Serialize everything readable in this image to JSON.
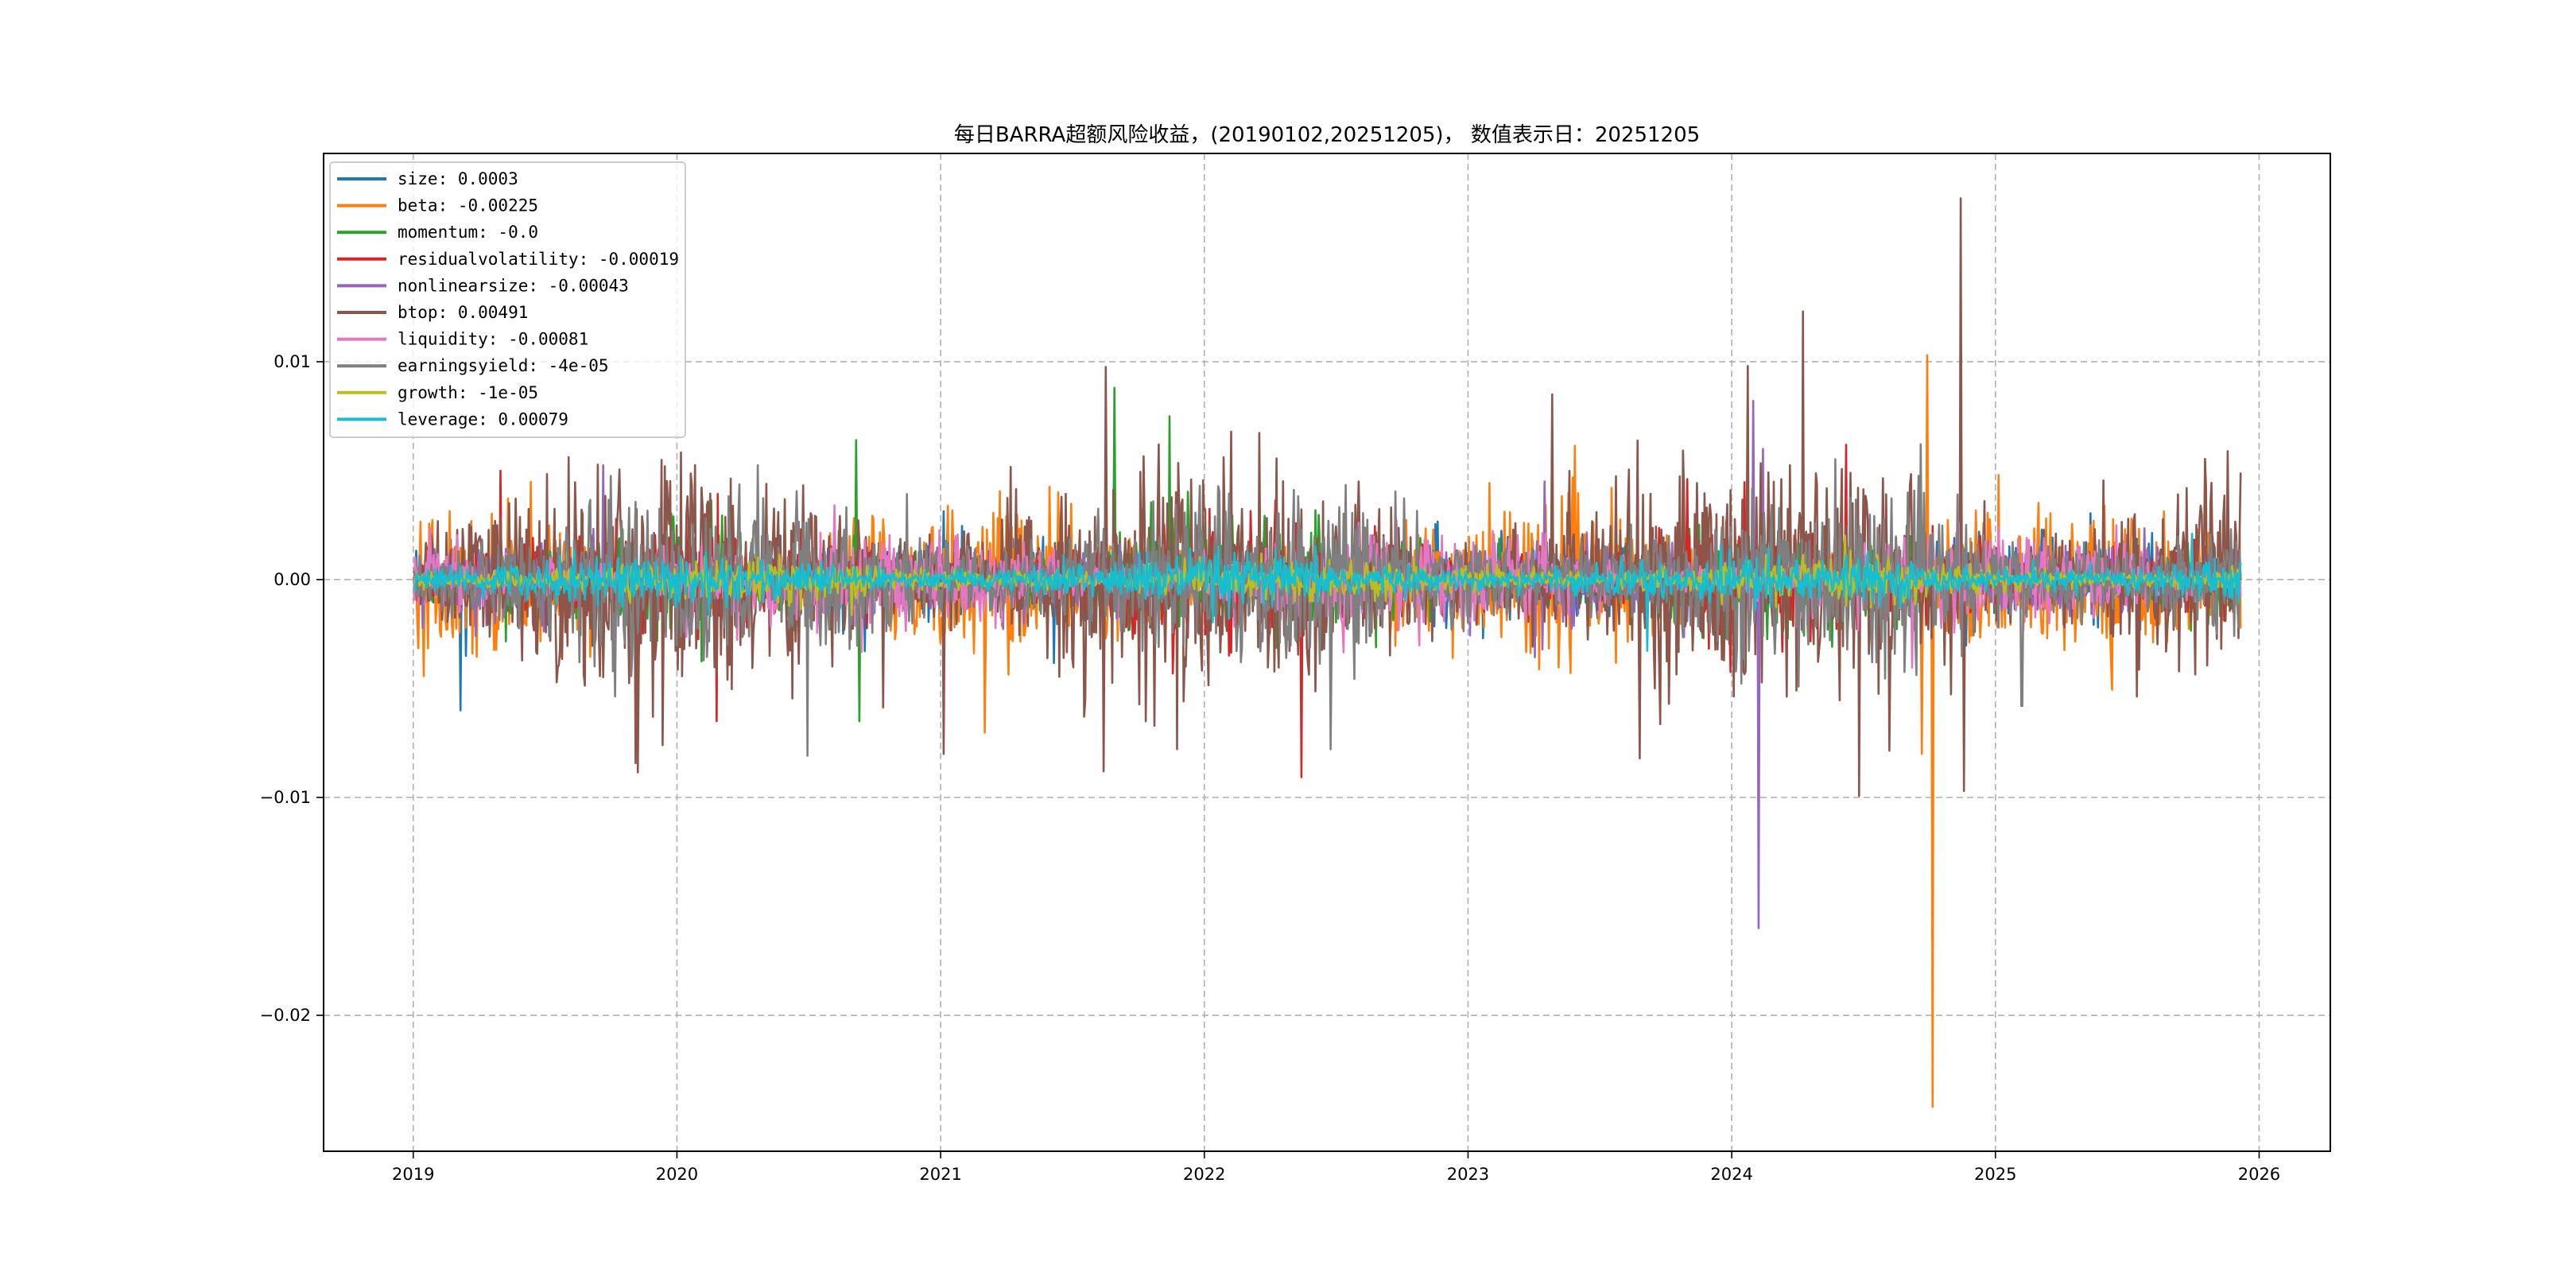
{
  "chart_data": {
    "type": "line",
    "title": "每日BARRA超额风险收益，(20190102,20251205)， 数值表示日：20251205",
    "xlabel": "",
    "ylabel": "",
    "xlim": [
      2018.66,
      2026.27
    ],
    "ylim": [
      -0.02624,
      0.01956
    ],
    "x_start": "20190102",
    "x_end": "20251205",
    "x_ticks": [
      "2019",
      "2020",
      "2021",
      "2022",
      "2023",
      "2024",
      "2025",
      "2026"
    ],
    "x_tick_values": [
      2019,
      2020,
      2021,
      2022,
      2023,
      2024,
      2025,
      2026
    ],
    "y_ticks": [
      "0.01",
      "0.00",
      "−0.01",
      "−0.02"
    ],
    "y_tick_values": [
      0.01,
      0,
      -0.01,
      -0.02
    ],
    "grid": true,
    "legend_placement": "top-left",
    "series": [
      {
        "name": "size",
        "label": "size: 0.0003",
        "last": 0.0003,
        "color": "#1f77b4",
        "typical_std": 0.0008,
        "spikes": [
          [
            2019.18,
            -0.006
          ],
          [
            2019.2,
            -0.0035
          ]
        ]
      },
      {
        "name": "beta",
        "label": "beta: -0.00225",
        "last": -0.00225,
        "color": "#ff7f0e",
        "typical_std": 0.0014,
        "spikes": [
          [
            2024.74,
            0.0103
          ],
          [
            2024.76,
            -0.0242
          ],
          [
            2024.72,
            -0.008
          ],
          [
            2024.1,
            -0.008
          ]
        ]
      },
      {
        "name": "momentum",
        "label": "momentum: -0.0",
        "last": 0.0,
        "color": "#2ca02c",
        "typical_std": 0.0011,
        "spikes": [
          [
            2020.68,
            0.0064
          ],
          [
            2020.69,
            -0.0065
          ],
          [
            2021.66,
            0.0088
          ],
          [
            2021.87,
            0.0075
          ]
        ]
      },
      {
        "name": "residualvolatility",
        "label": "residualvolatility: -0.00019",
        "last": -0.00019,
        "color": "#d62728",
        "typical_std": 0.0011,
        "spikes": [
          [
            2019.33,
            0.005
          ],
          [
            2020.15,
            -0.0065
          ]
        ]
      },
      {
        "name": "nonlinearsize",
        "label": "nonlinearsize: -0.00043",
        "last": -0.00043,
        "color": "#9467bd",
        "typical_std": 0.0007,
        "spikes": [
          [
            2024.08,
            0.0082
          ],
          [
            2024.1,
            -0.016
          ],
          [
            2024.12,
            0.006
          ]
        ]
      },
      {
        "name": "btop",
        "label": "btop: 0.00491",
        "last": 0.00491,
        "color": "#8c564b",
        "typical_std": 0.0024,
        "spikes": [
          [
            2024.06,
            0.0098
          ],
          [
            2024.87,
            0.0175
          ],
          [
            2024.88,
            -0.0097
          ],
          [
            2021.62,
            -0.0088
          ],
          [
            2023.32,
            0.0085
          ],
          [
            2021.01,
            -0.008
          ],
          [
            2023.65,
            -0.0082
          ]
        ]
      },
      {
        "name": "liquidity",
        "label": "liquidity: -0.00081",
        "last": -0.00081,
        "color": "#e377c2",
        "typical_std": 0.0009,
        "spikes": []
      },
      {
        "name": "earningsyield",
        "label": "earningsyield: -4e-05",
        "last": -4e-05,
        "color": "#7f7f7f",
        "typical_std": 0.0017,
        "spikes": [
          [
            2025.1,
            -0.0058
          ]
        ]
      },
      {
        "name": "growth",
        "label": "growth: -1e-05",
        "last": -1e-05,
        "color": "#bcbd22",
        "typical_std": 0.0004,
        "spikes": []
      },
      {
        "name": "leverage",
        "label": "leverage: 0.00079",
        "last": 0.00079,
        "color": "#17becf",
        "typical_std": 0.0005,
        "spikes": []
      }
    ]
  }
}
